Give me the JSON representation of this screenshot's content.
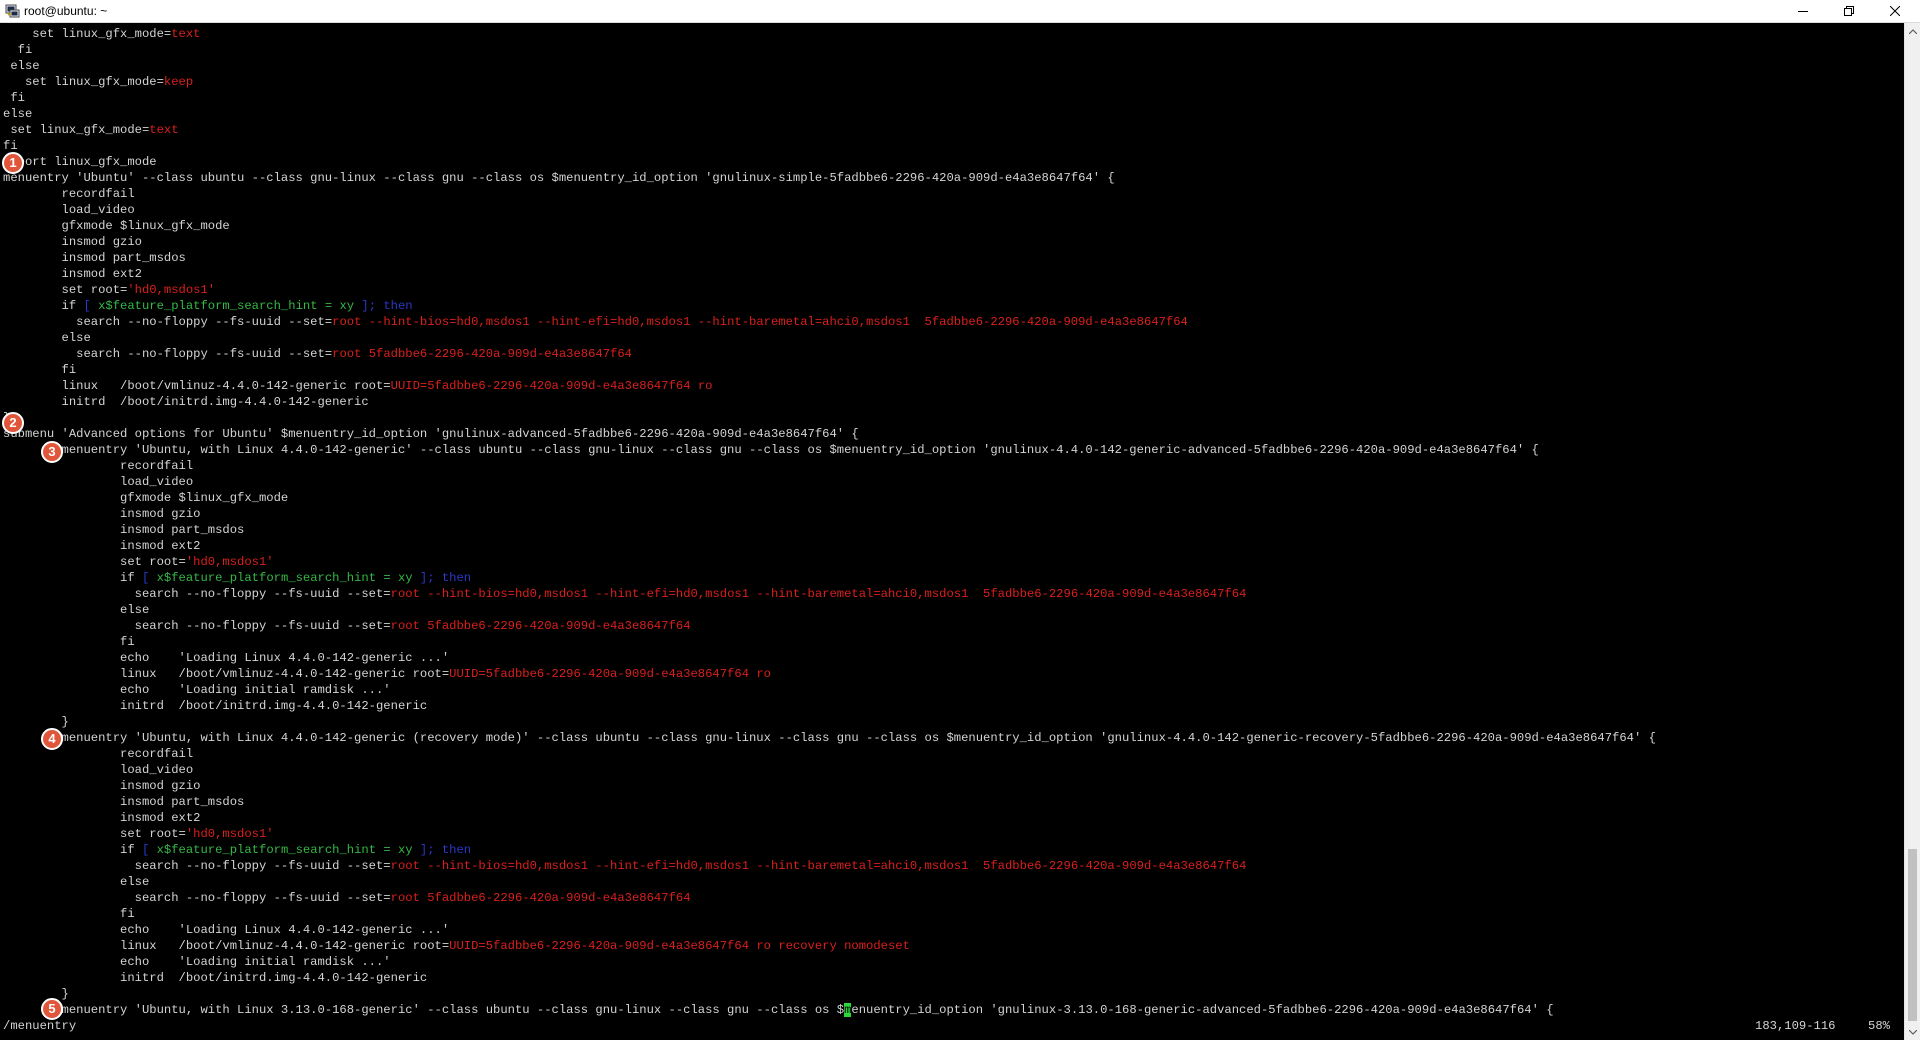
{
  "window": {
    "title": "root@ubuntu: ~",
    "app_icon": "putty-terminal-icon",
    "buttons": {
      "minimize_icon": "minimize-icon",
      "maximize_icon": "restore-icon",
      "close_icon": "close-icon"
    }
  },
  "colors": {
    "background": "#000000",
    "text": "#d4d4d4",
    "string_red": "#d9201c",
    "condition_green": "#34b847",
    "keyword_blue": "#2a38c8",
    "cursor_green": "#2bd93a",
    "marker_orange": "#e0563b"
  },
  "terminal": {
    "lines": [
      [
        [
          "    set linux_gfx_mode=",
          ""
        ],
        [
          "text",
          "r"
        ]
      ],
      [
        [
          "  fi",
          ""
        ]
      ],
      [
        [
          " else",
          ""
        ]
      ],
      [
        [
          "   set linux_gfx_mode=",
          ""
        ],
        [
          "keep",
          "r"
        ]
      ],
      [
        [
          " fi",
          ""
        ]
      ],
      [
        [
          "else",
          ""
        ]
      ],
      [
        [
          " set linux_gfx_mode=",
          ""
        ],
        [
          "text",
          "r"
        ]
      ],
      [
        [
          "fi",
          ""
        ]
      ],
      [
        [
          "export linux_gfx_mode",
          ""
        ]
      ],
      [
        [
          "menuentry 'Ubuntu' --class ubuntu --class gnu-linux --class gnu --class os $menuentry_id_option 'gnulinux-simple-5fadbbe6-2296-420a-909d-e4a3e8647f64' {",
          ""
        ]
      ],
      [
        [
          "        recordfail",
          ""
        ]
      ],
      [
        [
          "        load_video",
          ""
        ]
      ],
      [
        [
          "        gfxmode $linux_gfx_mode",
          ""
        ]
      ],
      [
        [
          "        insmod gzio",
          ""
        ]
      ],
      [
        [
          "        insmod part_msdos",
          ""
        ]
      ],
      [
        [
          "        insmod ext2",
          ""
        ]
      ],
      [
        [
          "        set root=",
          ""
        ],
        [
          "'hd0,msdos1'",
          "r"
        ]
      ],
      [
        [
          "        if ",
          ""
        ],
        [
          "[ ",
          "b"
        ],
        [
          "x$feature_platform_search_hint = xy",
          "g"
        ],
        [
          " ]; then",
          "b"
        ]
      ],
      [
        [
          "          search --no-floppy --fs-uuid --set=",
          ""
        ],
        [
          "root --hint-bios=hd0,msdos1 --hint-efi=hd0,msdos1 --hint-baremetal=ahci0,msdos1  5fadbbe6-2296-420a-909d-e4a3e8647f64",
          "r"
        ]
      ],
      [
        [
          "        else",
          ""
        ]
      ],
      [
        [
          "          search --no-floppy --fs-uuid --set=",
          ""
        ],
        [
          "root 5fadbbe6-2296-420a-909d-e4a3e8647f64",
          "r"
        ]
      ],
      [
        [
          "        fi",
          ""
        ]
      ],
      [
        [
          "        linux   /boot/vmlinuz-4.4.0-142-generic root=",
          ""
        ],
        [
          "UUID=5fadbbe6-2296-420a-909d-e4a3e8647f64 ro",
          "r"
        ]
      ],
      [
        [
          "        initrd  /boot/initrd.img-4.4.0-142-generic",
          ""
        ]
      ],
      [
        [
          "}",
          ""
        ]
      ],
      [
        [
          "submenu 'Advanced options for Ubuntu' $menuentry_id_option 'gnulinux-advanced-5fadbbe6-2296-420a-909d-e4a3e8647f64' {",
          ""
        ]
      ],
      [
        [
          "        menuentry 'Ubuntu, with Linux 4.4.0-142-generic' --class ubuntu --class gnu-linux --class gnu --class os $menuentry_id_option 'gnulinux-4.4.0-142-generic-advanced-5fadbbe6-2296-420a-909d-e4a3e8647f64' {",
          ""
        ]
      ],
      [
        [
          "                recordfail",
          ""
        ]
      ],
      [
        [
          "                load_video",
          ""
        ]
      ],
      [
        [
          "                gfxmode $linux_gfx_mode",
          ""
        ]
      ],
      [
        [
          "                insmod gzio",
          ""
        ]
      ],
      [
        [
          "                insmod part_msdos",
          ""
        ]
      ],
      [
        [
          "                insmod ext2",
          ""
        ]
      ],
      [
        [
          "                set root=",
          ""
        ],
        [
          "'hd0,msdos1'",
          "r"
        ]
      ],
      [
        [
          "                if ",
          ""
        ],
        [
          "[ ",
          "b"
        ],
        [
          "x$feature_platform_search_hint = xy",
          "g"
        ],
        [
          " ]; then",
          "b"
        ]
      ],
      [
        [
          "                  search --no-floppy --fs-uuid --set=",
          ""
        ],
        [
          "root --hint-bios=hd0,msdos1 --hint-efi=hd0,msdos1 --hint-baremetal=ahci0,msdos1  5fadbbe6-2296-420a-909d-e4a3e8647f64",
          "r"
        ]
      ],
      [
        [
          "                else",
          ""
        ]
      ],
      [
        [
          "                  search --no-floppy --fs-uuid --set=",
          ""
        ],
        [
          "root 5fadbbe6-2296-420a-909d-e4a3e8647f64",
          "r"
        ]
      ],
      [
        [
          "                fi",
          ""
        ]
      ],
      [
        [
          "                echo    'Loading Linux 4.4.0-142-generic ...'",
          ""
        ]
      ],
      [
        [
          "                linux   /boot/vmlinuz-4.4.0-142-generic root=",
          ""
        ],
        [
          "UUID=5fadbbe6-2296-420a-909d-e4a3e8647f64 ro",
          "r"
        ]
      ],
      [
        [
          "                echo    'Loading initial ramdisk ...'",
          ""
        ]
      ],
      [
        [
          "                initrd  /boot/initrd.img-4.4.0-142-generic",
          ""
        ]
      ],
      [
        [
          "        }",
          ""
        ]
      ],
      [
        [
          "        menuentry 'Ubuntu, with Linux 4.4.0-142-generic (recovery mode)' --class ubuntu --class gnu-linux --class gnu --class os $menuentry_id_option 'gnulinux-4.4.0-142-generic-recovery-5fadbbe6-2296-420a-909d-e4a3e8647f64' {",
          ""
        ]
      ],
      [
        [
          "                recordfail",
          ""
        ]
      ],
      [
        [
          "                load_video",
          ""
        ]
      ],
      [
        [
          "                insmod gzio",
          ""
        ]
      ],
      [
        [
          "                insmod part_msdos",
          ""
        ]
      ],
      [
        [
          "                insmod ext2",
          ""
        ]
      ],
      [
        [
          "                set root=",
          ""
        ],
        [
          "'hd0,msdos1'",
          "r"
        ]
      ],
      [
        [
          "                if ",
          ""
        ],
        [
          "[ ",
          "b"
        ],
        [
          "x$feature_platform_search_hint = xy",
          "g"
        ],
        [
          " ]; then",
          "b"
        ]
      ],
      [
        [
          "                  search --no-floppy --fs-uuid --set=",
          ""
        ],
        [
          "root --hint-bios=hd0,msdos1 --hint-efi=hd0,msdos1 --hint-baremetal=ahci0,msdos1  5fadbbe6-2296-420a-909d-e4a3e8647f64",
          "r"
        ]
      ],
      [
        [
          "                else",
          ""
        ]
      ],
      [
        [
          "                  search --no-floppy --fs-uuid --set=",
          ""
        ],
        [
          "root 5fadbbe6-2296-420a-909d-e4a3e8647f64",
          "r"
        ]
      ],
      [
        [
          "                fi",
          ""
        ]
      ],
      [
        [
          "                echo    'Loading Linux 4.4.0-142-generic ...'",
          ""
        ]
      ],
      [
        [
          "                linux   /boot/vmlinuz-4.4.0-142-generic root=",
          ""
        ],
        [
          "UUID=5fadbbe6-2296-420a-909d-e4a3e8647f64 ro recovery nomodeset",
          "r"
        ]
      ],
      [
        [
          "                echo    'Loading initial ramdisk ...'",
          ""
        ]
      ],
      [
        [
          "                initrd  /boot/initrd.img-4.4.0-142-generic",
          ""
        ]
      ],
      [
        [
          "        }",
          ""
        ]
      ],
      [
        [
          "        menuentry 'Ubuntu, with Linux 3.13.0-168-generic' --class ubuntu --class gnu-linux --class gnu --class os $",
          ""
        ],
        [
          "m",
          "cursor"
        ],
        [
          "enuentry_id_option 'gnulinux-3.13.0-168-generic-advanced-5fadbbe6-2296-420a-909d-e4a3e8647f64' {",
          ""
        ]
      ]
    ]
  },
  "status": {
    "search_command": "/menuentry",
    "position": "183,109-116",
    "percent": "58%"
  },
  "markers": [
    "1",
    "2",
    "3",
    "4",
    "5"
  ]
}
